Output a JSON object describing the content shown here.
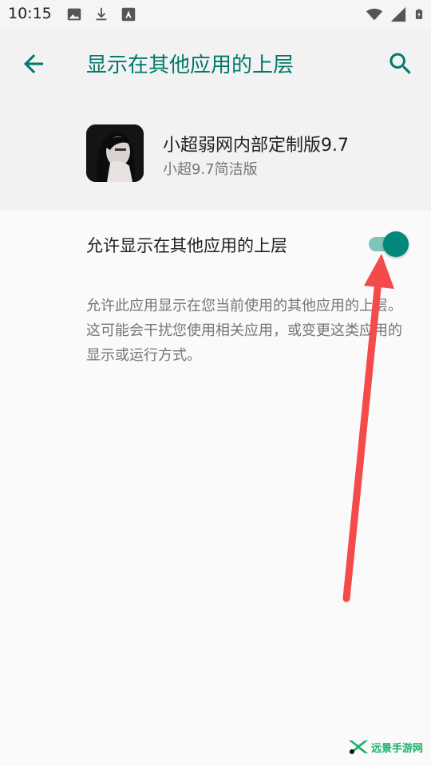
{
  "status_bar": {
    "time": "10:15",
    "left_icons": [
      "image-icon",
      "download-icon",
      "text-icon"
    ],
    "right_icons": [
      "wifi-icon",
      "signal-icon",
      "battery-icon"
    ]
  },
  "app_bar": {
    "title": "显示在其他应用的上层",
    "back_icon": "arrow-back-icon",
    "search_icon": "search-icon",
    "accent_color": "#00796b"
  },
  "app_info": {
    "name": "小超弱网内部定制版9.7",
    "version": "小超9.7简洁版"
  },
  "setting": {
    "label": "允许显示在其他应用的上层",
    "enabled": true,
    "description": "允许此应用显示在您当前使用的其他应用的上层。这可能会干扰您使用相关应用，或变更这类应用的显示或运行方式。"
  },
  "annotation": {
    "arrow_color": "#f44a4a"
  },
  "watermark": {
    "text": "远景手游网",
    "color": "#19b26b"
  }
}
